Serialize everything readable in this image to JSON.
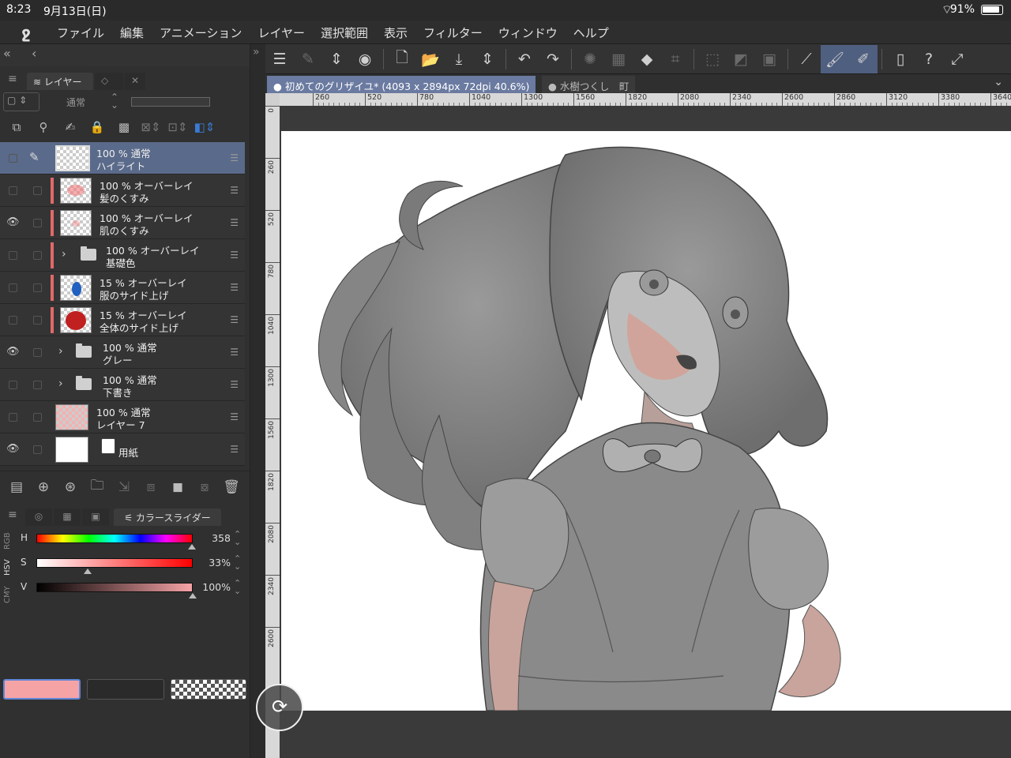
{
  "status_bar": {
    "time": "8:23",
    "date": "9月13日(日)",
    "battery": "91%"
  },
  "menu": {
    "items": [
      "ファイル",
      "編集",
      "アニメーション",
      "レイヤー",
      "選択範囲",
      "表示",
      "フィルター",
      "ウィンドウ",
      "ヘルプ"
    ]
  },
  "layer_panel": {
    "tab_label": "レイヤー",
    "blend_mode": "通常",
    "layers": [
      {
        "line1": "100 % 通常",
        "line2": "ハイライト"
      },
      {
        "line1": "100 % オーバーレイ",
        "line2": "髪のくすみ"
      },
      {
        "line1": "100 % オーバーレイ",
        "line2": "肌のくすみ"
      },
      {
        "line1": "100 % オーバーレイ",
        "line2": "基礎色"
      },
      {
        "line1": "15 % オーバーレイ",
        "line2": "服のサイド上げ"
      },
      {
        "line1": "15 % オーバーレイ",
        "line2": "全体のサイド上げ"
      },
      {
        "line1": "100 % 通常",
        "line2": "グレー"
      },
      {
        "line1": "100 % 通常",
        "line2": "下書き"
      },
      {
        "line1": "100 % 通常",
        "line2": "レイヤー 7"
      },
      {
        "line1": "用紙",
        "line2": ""
      }
    ]
  },
  "color_panel": {
    "tab_label": "カラースライダー",
    "modes": [
      "RGB",
      "HSV",
      "CMY"
    ],
    "sliders": [
      {
        "label": "H",
        "value": "358",
        "level": 0.994
      },
      {
        "label": "S",
        "value": "33%",
        "level": 0.33
      },
      {
        "label": "V",
        "value": "100%",
        "level": 1.0
      }
    ],
    "main_color": "#f6a3a6"
  },
  "document": {
    "active_tab": "初めてのグリザイユ* (4093 x 2894px 72dpi 40.6%)",
    "inactive_tab": "水樹つくし　町"
  },
  "ruler": {
    "h_ticks": [
      "260",
      "520",
      "780",
      "1040",
      "1300",
      "1560",
      "1820",
      "2080",
      "2340",
      "2600",
      "2860",
      "3120",
      "3380",
      "3640"
    ],
    "v_ticks": [
      "0",
      "260",
      "520",
      "780",
      "1040",
      "1300",
      "1560",
      "1820",
      "2080",
      "2340",
      "2600"
    ]
  }
}
